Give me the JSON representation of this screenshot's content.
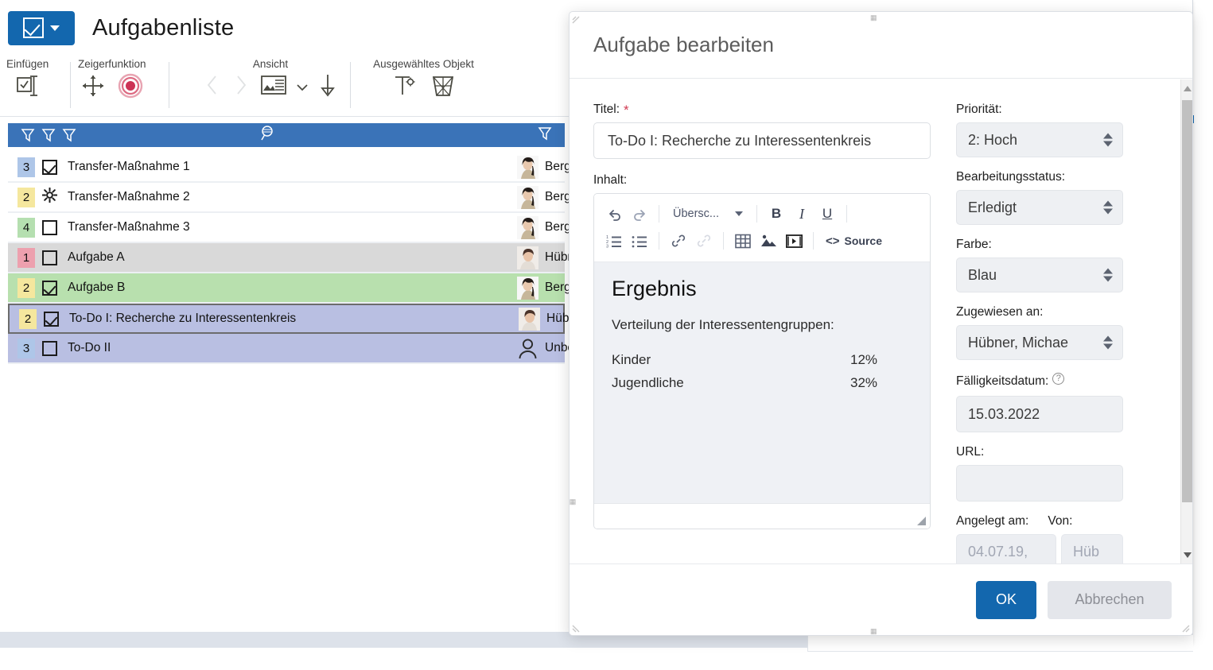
{
  "app": {
    "title": "Aufgabenliste",
    "menu_icon": "checkbox-menu-icon",
    "ribbon": {
      "groups": [
        {
          "label": "Einfügen",
          "icons": [
            "insert-task-icon"
          ]
        },
        {
          "label": "Zeigerfunktion",
          "icons": [
            "move-pointer-icon",
            "record-target-icon"
          ]
        },
        {
          "label": "Ansicht",
          "icons": [
            "prev-icon",
            "next-icon",
            "layout-view-icon",
            "view-dropdown-icon",
            "sort-down-icon"
          ]
        },
        {
          "label": "Ausgewähltes Objekt",
          "icons": [
            "text-settings-icon",
            "delete-trash-icon"
          ]
        }
      ]
    },
    "filterbar": {
      "icons": [
        "filter-icon-1",
        "filter-icon-2",
        "filter-icon-3"
      ],
      "search_icon": "search-icon",
      "right_icon": "filter-icon-right"
    },
    "list": {
      "rows": [
        {
          "prio": "3",
          "prio_color": "blue",
          "state": "checked",
          "title": "Transfer-Maßnahme 1",
          "assignee": "Berg",
          "avatar": "avatar-female",
          "row_style": "white",
          "focused": false
        },
        {
          "prio": "2",
          "prio_color": "yellow",
          "state": "gear",
          "title": "Transfer-Maßnahme 2",
          "assignee": "Berg",
          "avatar": "avatar-female",
          "row_style": "white",
          "focused": false
        },
        {
          "prio": "4",
          "prio_color": "green",
          "state": "unchecked",
          "title": "Transfer-Maßnahme 3",
          "assignee": "Berg",
          "avatar": "avatar-female",
          "row_style": "white",
          "focused": false
        },
        {
          "prio": "1",
          "prio_color": "red",
          "state": "unchecked",
          "title": "Aufgabe A",
          "assignee": "Hübr",
          "avatar": "avatar-male",
          "row_style": "sel-grey",
          "focused": false
        },
        {
          "prio": "2",
          "prio_color": "yellow",
          "state": "checked",
          "title": "Aufgabe B",
          "assignee": "Berg",
          "avatar": "avatar-female",
          "row_style": "sel-green",
          "focused": false
        },
        {
          "prio": "2",
          "prio_color": "yellow",
          "state": "checked",
          "title": "To-Do I: Recherche zu Interessentenkreis",
          "assignee": "Hübi",
          "avatar": "avatar-male",
          "row_style": "sel-blue",
          "focused": true
        },
        {
          "prio": "3",
          "prio_color": "blue",
          "state": "unchecked",
          "title": "To-Do II",
          "assignee": "Unbe",
          "avatar": "avatar-placeholder",
          "row_style": "sel-blue",
          "focused": false
        }
      ]
    }
  },
  "dialog": {
    "title": "Aufgabe bearbeiten",
    "fields": {
      "titel_label": "Titel:",
      "titel_required": "*",
      "titel_value": "To-Do I: Recherche zu Interessentenkreis",
      "inhalt_label": "Inhalt:",
      "prioritaet_label": "Priorität:",
      "prioritaet_value": "2: Hoch",
      "bearbeitungsstatus_label": "Bearbeitungsstatus:",
      "bearbeitungsstatus_value": "Erledigt",
      "farbe_label": "Farbe:",
      "farbe_value": "Blau",
      "zugewiesen_label": "Zugewiesen an:",
      "zugewiesen_value": "Hübner, Michae",
      "faelligkeit_label": "Fälligkeitsdatum:",
      "faelligkeit_value": "15.03.2022",
      "url_label": "URL:",
      "url_value": "",
      "angelegt_label": "Angelegt am:",
      "angelegt_value": "04.07.19,",
      "von_label": "Von:",
      "von_value": "Hüb"
    },
    "editor": {
      "toolbar_row1": [
        {
          "name": "undo-icon",
          "label": ""
        },
        {
          "name": "redo-icon",
          "label": ""
        },
        {
          "name": "heading-dropdown",
          "label": "Übersc..."
        },
        {
          "name": "bold-icon",
          "label": "B"
        },
        {
          "name": "italic-icon",
          "label": "I"
        },
        {
          "name": "underline-icon",
          "label": "U"
        }
      ],
      "toolbar_row2": [
        {
          "name": "numbered-list-icon",
          "label": ""
        },
        {
          "name": "bullet-list-icon",
          "label": ""
        },
        {
          "name": "link-icon",
          "label": ""
        },
        {
          "name": "unlink-icon",
          "label": ""
        },
        {
          "name": "table-icon",
          "label": ""
        },
        {
          "name": "image-icon",
          "label": ""
        },
        {
          "name": "media-icon",
          "label": ""
        },
        {
          "name": "source-button",
          "label": "Source"
        }
      ],
      "content": {
        "heading": "Ergebnis",
        "paragraph": "Verteilung der Interessentengruppen:",
        "pairs": [
          {
            "key": "Kinder",
            "value": "12%"
          },
          {
            "key": "Jugendliche",
            "value": "32%"
          }
        ]
      }
    },
    "buttons": {
      "ok": "OK",
      "cancel": "Abbrechen"
    }
  },
  "colors": {
    "accent_blue": "#1367ae",
    "filter_bar": "#3a73b8",
    "prio_blue": "#aec6e8",
    "prio_yellow": "#f5e79e",
    "prio_green": "#b5dfb0",
    "prio_red": "#eda0ae",
    "row_selected_grey": "#d9d9d9",
    "row_selected_green": "#b8e0ae",
    "row_selected_blue": "#b9bfe2",
    "editor_bg": "#eff1f5",
    "required_star": "#d03a52"
  }
}
